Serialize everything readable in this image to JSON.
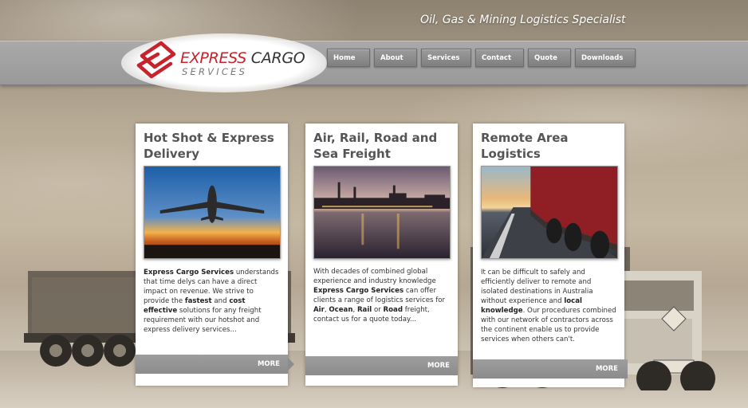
{
  "header": {
    "tagline": "Oil, Gas & Mining Logistics Specialist",
    "logo": {
      "word1": "EXPRESS",
      "word2": "CARGO",
      "line2": "SERVICES"
    }
  },
  "nav": {
    "items": [
      {
        "label": "Home",
        "active": true
      },
      {
        "label": "About",
        "active": false
      },
      {
        "label": "Services",
        "active": false
      },
      {
        "label": "Contact",
        "active": false
      },
      {
        "label": "Quote",
        "active": false
      },
      {
        "label": "Downloads",
        "active": false
      }
    ]
  },
  "cards": [
    {
      "title": "Hot Shot & Express Delivery",
      "photo": "airplane-sunset",
      "body": [
        {
          "t": "Express Cargo Services",
          "b": true
        },
        {
          "t": " understands that time delys can have a direct impact on revenue. We strive to provide the ",
          "b": false
        },
        {
          "t": "fastest",
          "b": true
        },
        {
          "t": " and ",
          "b": false
        },
        {
          "t": "cost effective",
          "b": true
        },
        {
          "t": " solutions for any freight requirement with our hotshot and express delivery services...",
          "b": false
        }
      ],
      "more": "MORE"
    },
    {
      "title": "Air, Rail, Road and Sea Freight",
      "photo": "port-at-dusk",
      "body": [
        {
          "t": "With decades of combined global experience and industry knowledge ",
          "b": false
        },
        {
          "t": "Express Cargo Services",
          "b": true
        },
        {
          "t": " can offer clients a range of logistics services for ",
          "b": false
        },
        {
          "t": "Air",
          "b": true
        },
        {
          "t": ", ",
          "b": false
        },
        {
          "t": "Ocean",
          "b": true
        },
        {
          "t": ", ",
          "b": false
        },
        {
          "t": "Rail",
          "b": true
        },
        {
          "t": " or ",
          "b": false
        },
        {
          "t": "Road",
          "b": true
        },
        {
          "t": " freight, contact us for a quote today...",
          "b": false
        }
      ],
      "more": "MORE"
    },
    {
      "title": "Remote Area Logistics",
      "photo": "truck-on-road",
      "body": [
        {
          "t": "It can be difficult to safely and efficiently deliver to remote and isolated destinations in Australia without experience and ",
          "b": false
        },
        {
          "t": "local knowledge",
          "b": true
        },
        {
          "t": ". Our procedures combined with our network of contractors across the continent enable us to provide services when others can't.",
          "b": false
        }
      ],
      "more": "MORE"
    }
  ],
  "colors": {
    "brand_red": "#c8232c",
    "nav_bar": "#a3a3a3",
    "more_bar": "#939393"
  }
}
